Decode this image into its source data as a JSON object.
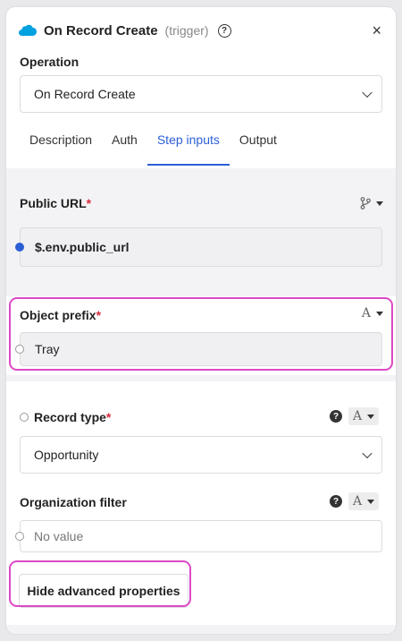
{
  "header": {
    "title": "On Record Create",
    "subtitle": "(trigger)",
    "help": "?",
    "close": "×"
  },
  "operation": {
    "label": "Operation",
    "value": "On Record Create"
  },
  "tabs": [
    {
      "label": "Description",
      "active": false
    },
    {
      "label": "Auth",
      "active": false
    },
    {
      "label": "Step inputs",
      "active": true
    },
    {
      "label": "Output",
      "active": false
    }
  ],
  "fields": {
    "public_url": {
      "label": "Public URL",
      "required": "*",
      "value": "$.env.public_url"
    },
    "object_prefix": {
      "label": "Object prefix",
      "required": "*",
      "value": "Tray",
      "type_glyph": "A"
    },
    "record_type": {
      "label": "Record type",
      "required": "*",
      "value": "Opportunity",
      "type_glyph": "A",
      "help": "?"
    },
    "organization_filter": {
      "label": "Organization filter",
      "value": "No value",
      "type_glyph": "A",
      "help": "?"
    }
  },
  "advanced_button": "Hide advanced properties",
  "colors": {
    "accent": "#2c5fd6",
    "highlight": "#dc49c6",
    "required": "#d62c3c",
    "salesforce": "#00a1e0"
  },
  "icons": [
    "salesforce-logo-icon",
    "help-icon",
    "close-icon",
    "chevron-down-icon",
    "branch-icon",
    "type-a-icon",
    "caret-down-icon"
  ]
}
